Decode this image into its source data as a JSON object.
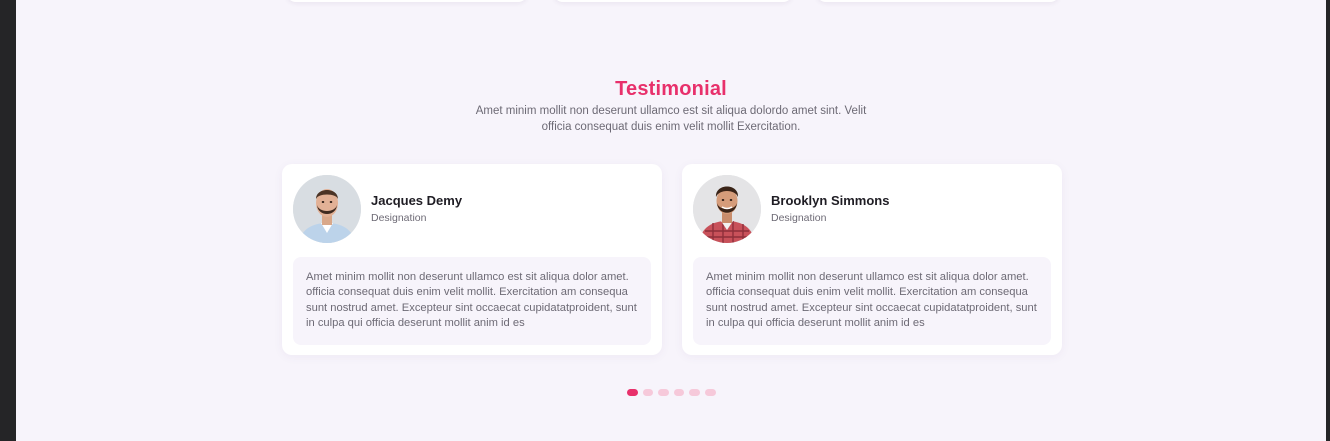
{
  "section": {
    "title": "Testimonial",
    "description": "Amet minim mollit non deserunt ullamco est sit aliqua dolordo amet sint. Velit officia consequat duis enim velit mollit Exercitation."
  },
  "testimonials": [
    {
      "name": "Jacques Demy",
      "designation": "Designation",
      "quote": "Amet minim mollit non deserunt ullamco est sit aliqua dolor amet. officia consequat duis enim velit mollit. Exercitation am consequa sunt nostrud amet. Excepteur sint occaecat cupidatatproident, sunt in culpa qui officia deserunt mollit anim id es",
      "avatar_icon": "man-light-blue-shirt-avatar"
    },
    {
      "name": "Brooklyn Simmons",
      "designation": "Designation",
      "quote": "Amet minim mollit non deserunt ullamco est sit aliqua dolor amet. officia consequat duis enim velit mollit. Exercitation am consequa sunt nostrud amet. Excepteur sint occaecat cupidatatproident, sunt in culpa qui officia deserunt mollit anim id es",
      "avatar_icon": "man-plaid-shirt-avatar"
    }
  ],
  "pagination": {
    "total": 6,
    "active_index": 0
  },
  "colors": {
    "accent": "#e8306b",
    "dot_inactive": "#f6c9da",
    "page_background": "#f7f4fb",
    "card_background": "#ffffff"
  }
}
